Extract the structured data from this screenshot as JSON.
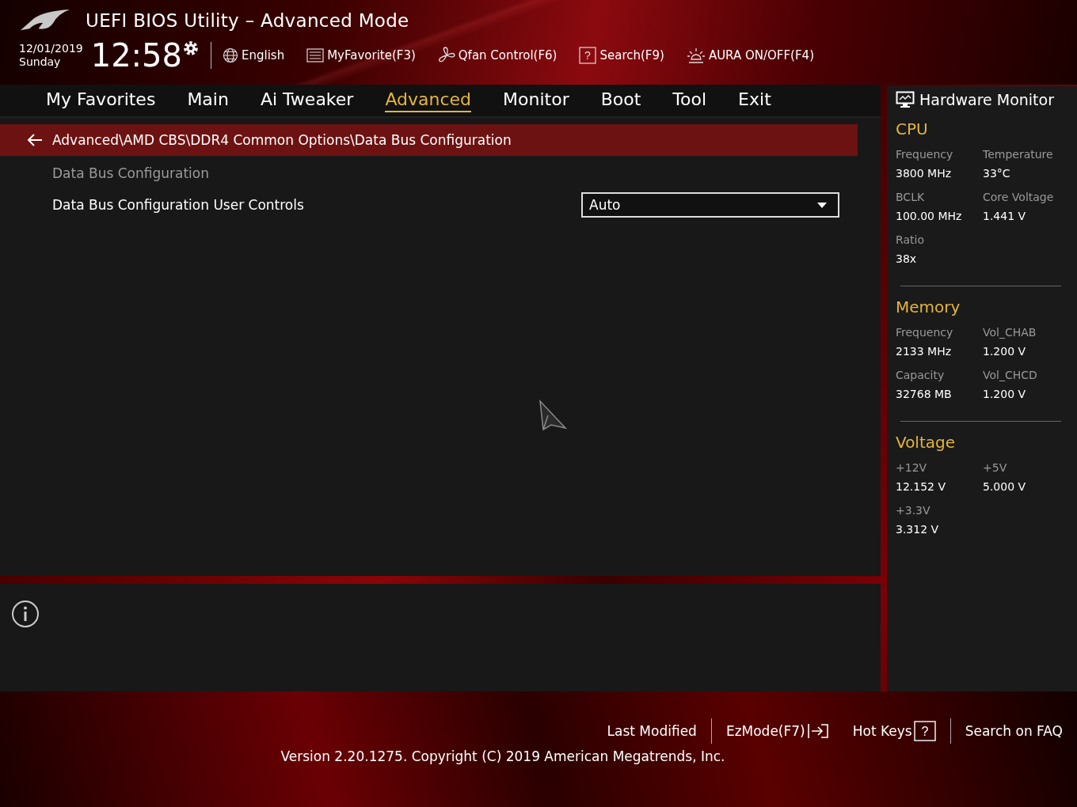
{
  "header": {
    "title": "UEFI BIOS Utility – Advanced Mode",
    "date": "12/01/2019",
    "day": "Sunday",
    "time": "12:58",
    "tools": [
      {
        "kind": "language",
        "label": "English"
      },
      {
        "kind": "favorite",
        "label": "MyFavorite(F3)"
      },
      {
        "kind": "fan",
        "label": "Qfan Control(F6)"
      },
      {
        "kind": "search",
        "label": "Search(F9)",
        "glyph": "?"
      },
      {
        "kind": "aura",
        "label": "AURA ON/OFF(F4)"
      }
    ]
  },
  "tabs": [
    {
      "label": "My Favorites",
      "selected": false
    },
    {
      "label": "Main",
      "selected": false
    },
    {
      "label": "Ai Tweaker",
      "selected": false
    },
    {
      "label": "Advanced",
      "selected": true
    },
    {
      "label": "Monitor",
      "selected": false
    },
    {
      "label": "Boot",
      "selected": false
    },
    {
      "label": "Tool",
      "selected": false
    },
    {
      "label": "Exit",
      "selected": false
    }
  ],
  "breadcrumb": "Advanced\\AMD CBS\\DDR4 Common Options\\Data Bus Configuration",
  "settings": [
    {
      "kind": "heading",
      "label": "Data Bus Configuration"
    },
    {
      "kind": "dropdown",
      "label": "Data Bus Configuration User Controls",
      "value": "Auto"
    }
  ],
  "hardware_monitor": {
    "title": "Hardware Monitor",
    "groups": [
      {
        "name": "CPU",
        "items": [
          {
            "label": "Frequency",
            "value": "3800 MHz"
          },
          {
            "label": "Temperature",
            "value": "33°C"
          },
          {
            "label": "BCLK",
            "value": "100.00 MHz"
          },
          {
            "label": "Core Voltage",
            "value": "1.441 V"
          },
          {
            "label": "Ratio",
            "value": "38x"
          }
        ]
      },
      {
        "name": "Memory",
        "items": [
          {
            "label": "Frequency",
            "value": "2133 MHz"
          },
          {
            "label": "Vol_CHAB",
            "value": "1.200 V"
          },
          {
            "label": "Capacity",
            "value": "32768 MB"
          },
          {
            "label": "Vol_CHCD",
            "value": "1.200 V"
          }
        ]
      },
      {
        "name": "Voltage",
        "items": [
          {
            "label": "+12V",
            "value": "12.152 V"
          },
          {
            "label": "+5V",
            "value": "5.000 V"
          },
          {
            "label": "+3.3V",
            "value": "3.312 V"
          }
        ]
      }
    ]
  },
  "footer": {
    "actions": [
      {
        "kind": "plain",
        "label": "Last Modified"
      },
      {
        "kind": "ezmode",
        "label": "EzMode(F7)"
      },
      {
        "kind": "hotkeys",
        "label": "Hot Keys",
        "glyph": "?"
      },
      {
        "kind": "plain",
        "label": "Search on FAQ"
      }
    ],
    "version": "Version 2.20.1275. Copyright (C) 2019 American Megatrends, Inc."
  }
}
